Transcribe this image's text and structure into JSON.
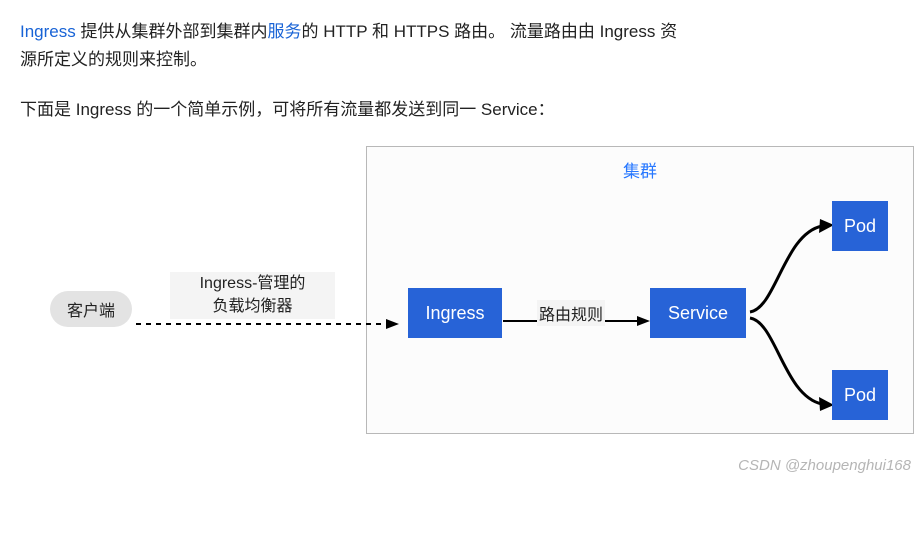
{
  "para1": {
    "link1": "Ingress",
    "seg1": " 提供从集群外部到集群内",
    "link2": "服务",
    "seg2": "的 HTTP 和 HTTPS 路由。 流量路由由 Ingress 资源所定义的规则来控制。"
  },
  "para2": "下面是 Ingress 的一个简单示例，可将所有流量都发送到同一 Service：",
  "diagram": {
    "cluster": "集群",
    "client": "客户端",
    "lb_line1": "Ingress-管理的",
    "lb_line2": "负载均衡器",
    "ingress": "Ingress",
    "route_rule": "路由规则",
    "service": "Service",
    "pod": "Pod"
  },
  "watermark": "CSDN @zhoupenghui168"
}
